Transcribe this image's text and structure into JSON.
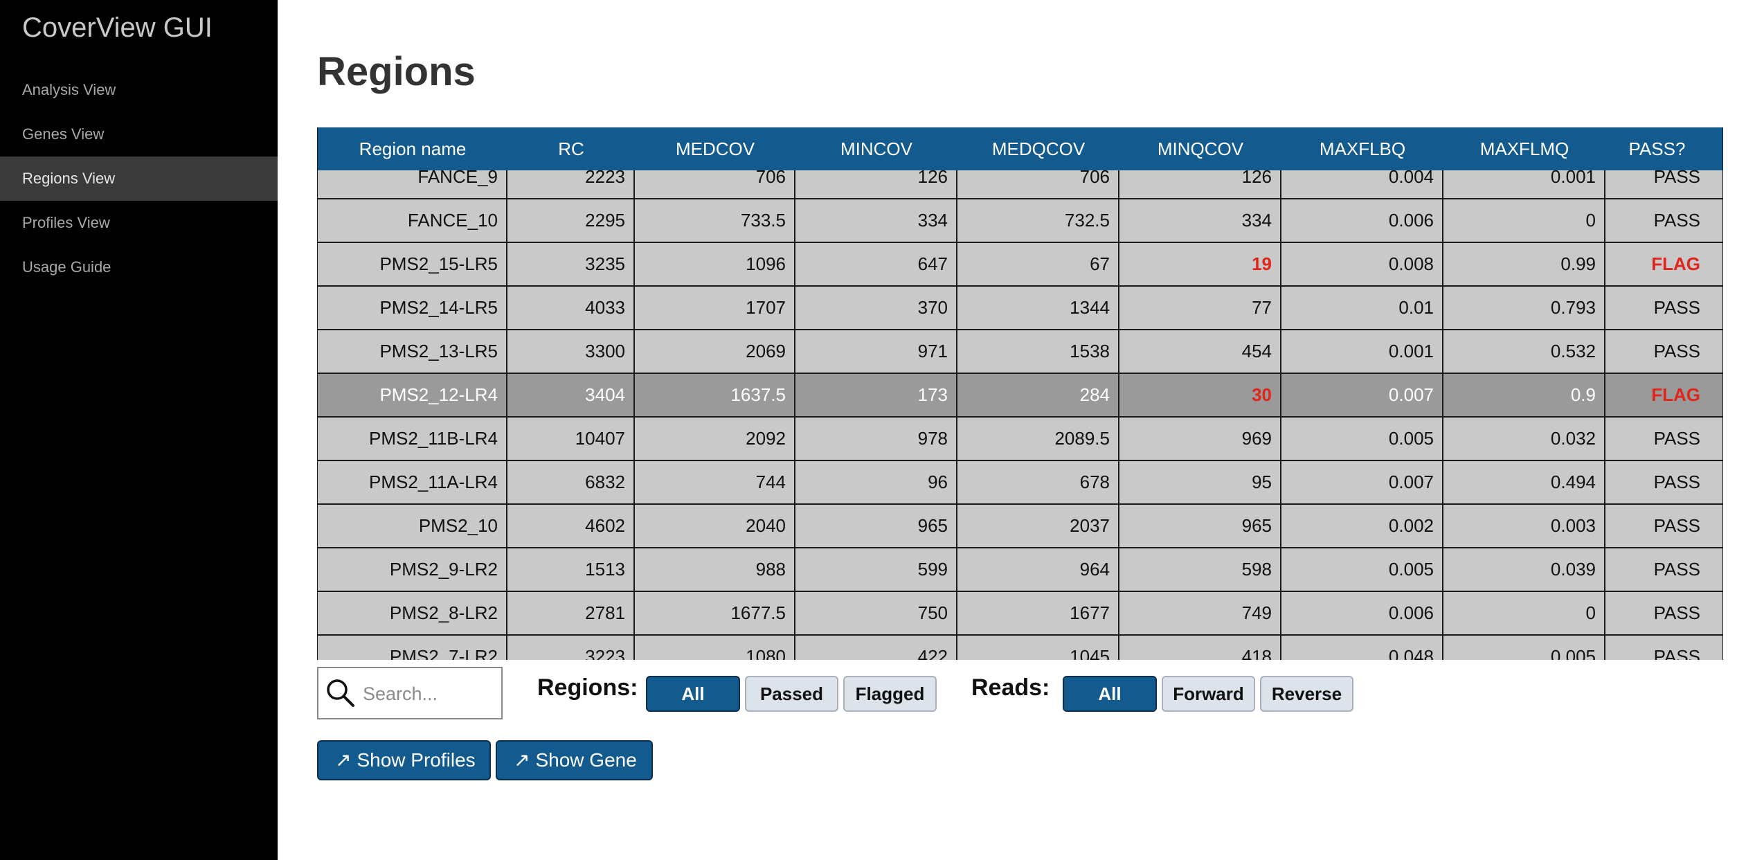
{
  "app": {
    "title": "CoverView GUI"
  },
  "sidebar": {
    "items": [
      {
        "label": "Analysis View",
        "active": false
      },
      {
        "label": "Genes View",
        "active": false
      },
      {
        "label": "Regions View",
        "active": true
      },
      {
        "label": "Profiles View",
        "active": false
      },
      {
        "label": "Usage Guide",
        "active": false
      }
    ]
  },
  "page": {
    "title": "Regions"
  },
  "table": {
    "columns": [
      "Region name",
      "RC",
      "MEDCOV",
      "MINCOV",
      "MEDQCOV",
      "MINQCOV",
      "MAXFLBQ",
      "MAXFLMQ",
      "PASS?"
    ],
    "rows": [
      {
        "cells": [
          "FANCE_9",
          "2223",
          "706",
          "126",
          "706",
          "126",
          "0.004",
          "0.001",
          "PASS"
        ],
        "selected": false,
        "flag_cols": []
      },
      {
        "cells": [
          "FANCE_10",
          "2295",
          "733.5",
          "334",
          "732.5",
          "334",
          "0.006",
          "0",
          "PASS"
        ],
        "selected": false,
        "flag_cols": []
      },
      {
        "cells": [
          "PMS2_15-LR5",
          "3235",
          "1096",
          "647",
          "67",
          "19",
          "0.008",
          "0.99",
          "FLAG"
        ],
        "selected": false,
        "flag_cols": [
          5,
          8
        ]
      },
      {
        "cells": [
          "PMS2_14-LR5",
          "4033",
          "1707",
          "370",
          "1344",
          "77",
          "0.01",
          "0.793",
          "PASS"
        ],
        "selected": false,
        "flag_cols": []
      },
      {
        "cells": [
          "PMS2_13-LR5",
          "3300",
          "2069",
          "971",
          "1538",
          "454",
          "0.001",
          "0.532",
          "PASS"
        ],
        "selected": false,
        "flag_cols": []
      },
      {
        "cells": [
          "PMS2_12-LR4",
          "3404",
          "1637.5",
          "173",
          "284",
          "30",
          "0.007",
          "0.9",
          "FLAG"
        ],
        "selected": true,
        "flag_cols": [
          5,
          8
        ]
      },
      {
        "cells": [
          "PMS2_11B-LR4",
          "10407",
          "2092",
          "978",
          "2089.5",
          "969",
          "0.005",
          "0.032",
          "PASS"
        ],
        "selected": false,
        "flag_cols": []
      },
      {
        "cells": [
          "PMS2_11A-LR4",
          "6832",
          "744",
          "96",
          "678",
          "95",
          "0.007",
          "0.494",
          "PASS"
        ],
        "selected": false,
        "flag_cols": []
      },
      {
        "cells": [
          "PMS2_10",
          "4602",
          "2040",
          "965",
          "2037",
          "965",
          "0.002",
          "0.003",
          "PASS"
        ],
        "selected": false,
        "flag_cols": []
      },
      {
        "cells": [
          "PMS2_9-LR2",
          "1513",
          "988",
          "599",
          "964",
          "598",
          "0.005",
          "0.039",
          "PASS"
        ],
        "selected": false,
        "flag_cols": []
      },
      {
        "cells": [
          "PMS2_8-LR2",
          "2781",
          "1677.5",
          "750",
          "1677",
          "749",
          "0.006",
          "0",
          "PASS"
        ],
        "selected": false,
        "flag_cols": []
      },
      {
        "cells": [
          "PMS2_7-LR2",
          "3223",
          "1080",
          "422",
          "1045",
          "418",
          "0.048",
          "0.005",
          "PASS"
        ],
        "selected": false,
        "flag_cols": []
      }
    ]
  },
  "search": {
    "placeholder": "Search...",
    "value": ""
  },
  "filters": {
    "regions_label": "Regions:",
    "regions_options": [
      {
        "label": "All",
        "active": true
      },
      {
        "label": "Passed",
        "active": false
      },
      {
        "label": "Flagged",
        "active": false
      }
    ],
    "reads_label": "Reads:",
    "reads_options": [
      {
        "label": "All",
        "active": true
      },
      {
        "label": "Forward",
        "active": false
      },
      {
        "label": "Reverse",
        "active": false
      }
    ]
  },
  "actions": {
    "show_profiles": "Show Profiles",
    "show_gene": "Show Gene",
    "arrow_glyph": "↗"
  },
  "colors": {
    "accent": "#135a8e",
    "flag": "#e0251b",
    "row_bg": "#c9c9c9",
    "row_selected_bg": "#9a9a9a",
    "sidebar_bg": "#000000"
  }
}
